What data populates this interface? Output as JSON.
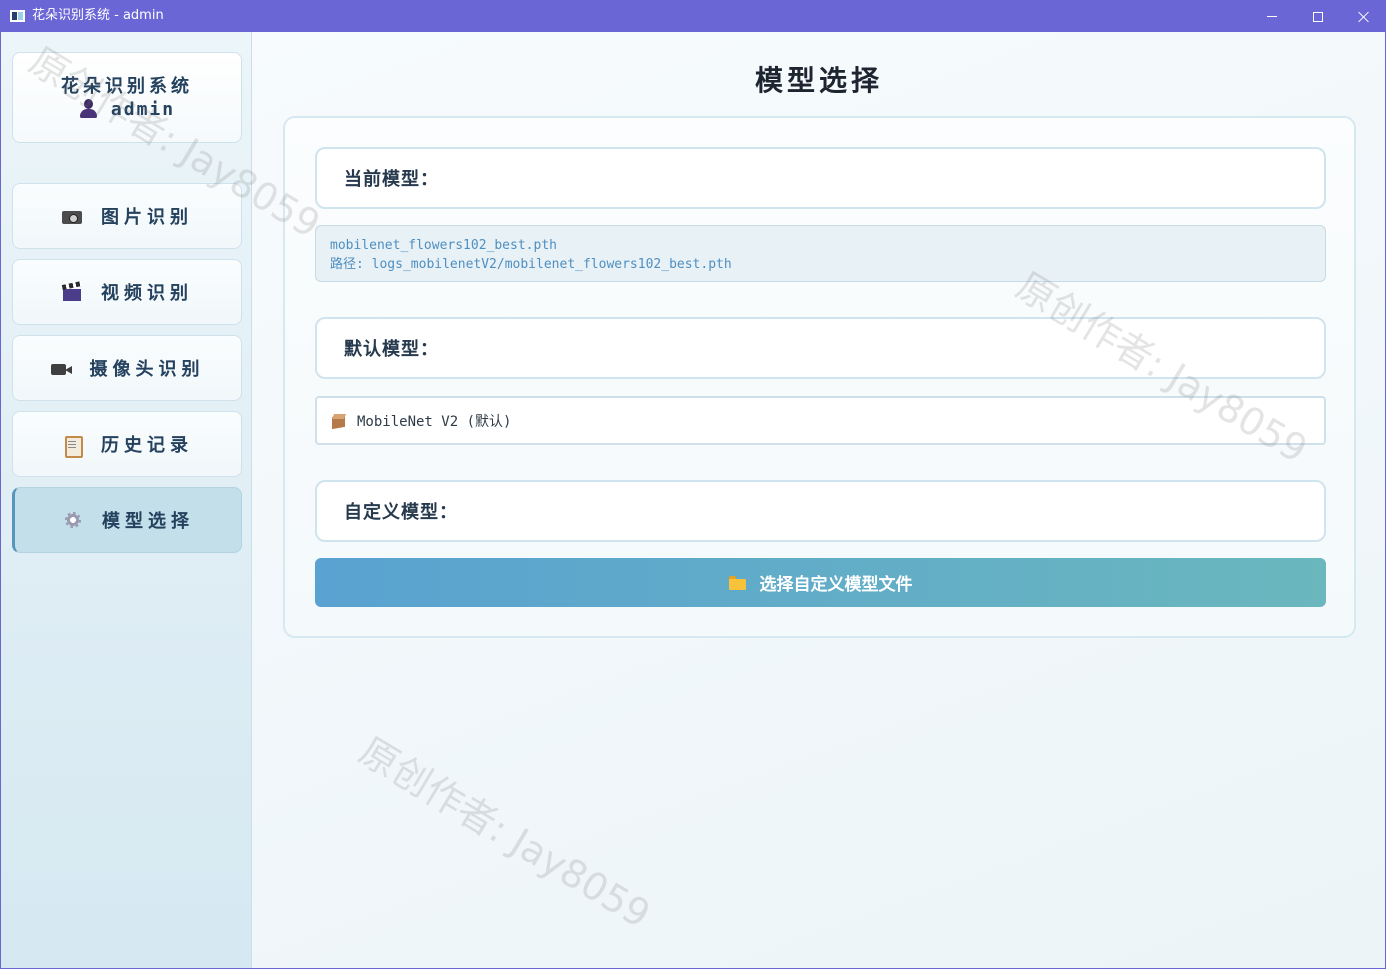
{
  "window": {
    "title": "花朵识别系统 - admin"
  },
  "sidebar": {
    "app_name": "花朵识别系统",
    "username": "admin",
    "items": [
      {
        "label": "图片识别",
        "icon": "camera-icon",
        "active": false
      },
      {
        "label": "视频识别",
        "icon": "clapperboard-icon",
        "active": false
      },
      {
        "label": "摄像头识别",
        "icon": "video-camera-icon",
        "active": false
      },
      {
        "label": "历史记录",
        "icon": "clipboard-icon",
        "active": false
      },
      {
        "label": "模型选择",
        "icon": "gear-icon",
        "active": true
      }
    ]
  },
  "main": {
    "title": "模型选择",
    "current_model": {
      "label": "当前模型：",
      "file": "mobilenet_flowers102_best.pth",
      "path": "路径: logs_mobilenetV2/mobilenet_flowers102_best.pth"
    },
    "default_model": {
      "label": "默认模型：",
      "selected": "MobileNet V2 (默认)",
      "icon": "package-icon"
    },
    "custom_model": {
      "label": "自定义模型：",
      "button_label": "选择自定义模型文件",
      "button_icon": "folder-icon"
    }
  },
  "watermark": "原创作者: Jay8059",
  "colors": {
    "titlebar": "#6b66d6",
    "accent": "#5796bb",
    "button_start": "#59a2d1",
    "button_end": "#6ab7be",
    "path_text": "#4f8fc0"
  }
}
